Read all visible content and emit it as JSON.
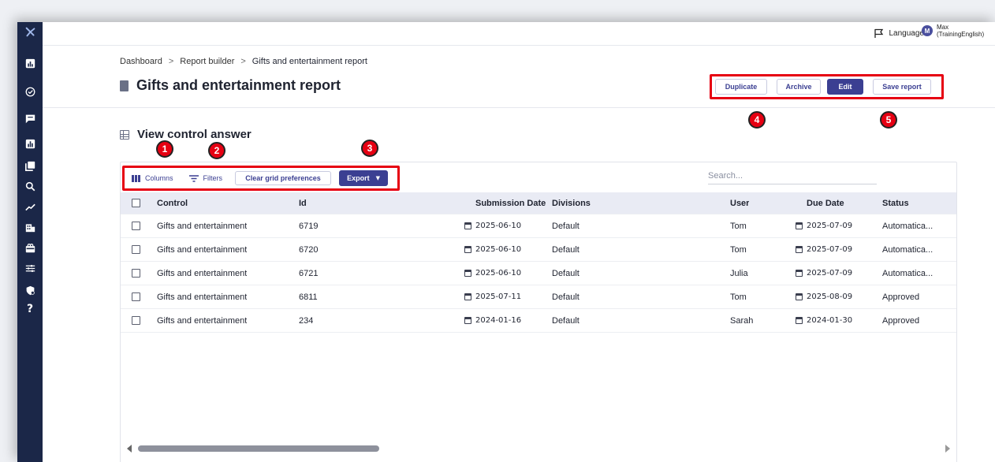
{
  "topbar": {
    "language_label": "Language",
    "user_initial": "M",
    "user_name": "Max (TrainingEnglish)"
  },
  "breadcrumb": [
    "Dashboard",
    "Report builder",
    "Gifts and entertainment report"
  ],
  "breadcrumb_separator": ">",
  "page": {
    "title": "Gifts and entertainment report",
    "section_title": "View control answer"
  },
  "actions": {
    "duplicate": "Duplicate",
    "archive": "Archive",
    "edit": "Edit",
    "save": "Save report"
  },
  "toolbar": {
    "columns": "Columns",
    "filters": "Filters",
    "clear": "Clear grid preferences",
    "export": "Export"
  },
  "search": {
    "placeholder": "Search..."
  },
  "callouts": [
    "1",
    "2",
    "3",
    "4",
    "5"
  ],
  "table": {
    "columns": [
      "Control",
      "Id",
      "Submission Date",
      "Divisions",
      "User",
      "Due Date",
      "Status"
    ],
    "rows": [
      [
        "Gifts and entertainment",
        "6719",
        "2025-06-10",
        "Default",
        "Tom",
        "2025-07-09",
        "Automatica..."
      ],
      [
        "Gifts and entertainment",
        "6720",
        "2025-06-10",
        "Default",
        "Tom",
        "2025-07-09",
        "Automatica..."
      ],
      [
        "Gifts and entertainment",
        "6721",
        "2025-06-10",
        "Default",
        "Julia",
        "2025-07-09",
        "Automatica..."
      ],
      [
        "Gifts and entertainment",
        "6811",
        "2025-07-11",
        "Default",
        "Tom",
        "2025-08-09",
        "Approved"
      ],
      [
        "Gifts and entertainment",
        "234",
        "2024-01-16",
        "Default",
        "Sarah",
        "2024-01-30",
        "Approved"
      ]
    ]
  },
  "colors": {
    "sidebar": "#1b2748",
    "primary": "#3b3f92",
    "callout": "#e60012"
  },
  "sidebar_icons": [
    "logo-icon",
    "dashboard-icon",
    "check-icon",
    "chat-icon",
    "report-icon",
    "library-icon",
    "search-icon",
    "trend-icon",
    "building-icon",
    "gift-icon",
    "settings-icon",
    "shield-icon",
    "help-icon"
  ]
}
